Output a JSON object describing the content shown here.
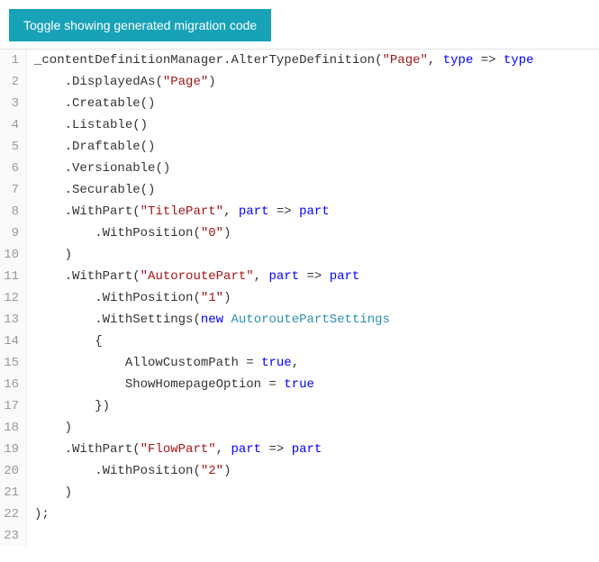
{
  "button": {
    "label": "Toggle showing generated migration code"
  },
  "code": {
    "lines": [
      [
        {
          "t": "ident",
          "v": "_contentDefinitionManager"
        },
        {
          "t": "punct",
          "v": "."
        },
        {
          "t": "ident",
          "v": "AlterTypeDefinition"
        },
        {
          "t": "punct",
          "v": "("
        },
        {
          "t": "string",
          "v": "\"Page\""
        },
        {
          "t": "punct",
          "v": ", "
        },
        {
          "t": "keyword",
          "v": "type"
        },
        {
          "t": "punct",
          "v": " => "
        },
        {
          "t": "keyword",
          "v": "type"
        }
      ],
      [
        {
          "t": "punct",
          "v": "    ."
        },
        {
          "t": "ident",
          "v": "DisplayedAs"
        },
        {
          "t": "punct",
          "v": "("
        },
        {
          "t": "string",
          "v": "\"Page\""
        },
        {
          "t": "punct",
          "v": ")"
        }
      ],
      [
        {
          "t": "punct",
          "v": "    ."
        },
        {
          "t": "ident",
          "v": "Creatable"
        },
        {
          "t": "punct",
          "v": "()"
        }
      ],
      [
        {
          "t": "punct",
          "v": "    ."
        },
        {
          "t": "ident",
          "v": "Listable"
        },
        {
          "t": "punct",
          "v": "()"
        }
      ],
      [
        {
          "t": "punct",
          "v": "    ."
        },
        {
          "t": "ident",
          "v": "Draftable"
        },
        {
          "t": "punct",
          "v": "()"
        }
      ],
      [
        {
          "t": "punct",
          "v": "    ."
        },
        {
          "t": "ident",
          "v": "Versionable"
        },
        {
          "t": "punct",
          "v": "()"
        }
      ],
      [
        {
          "t": "punct",
          "v": "    ."
        },
        {
          "t": "ident",
          "v": "Securable"
        },
        {
          "t": "punct",
          "v": "()"
        }
      ],
      [
        {
          "t": "punct",
          "v": "    ."
        },
        {
          "t": "ident",
          "v": "WithPart"
        },
        {
          "t": "punct",
          "v": "("
        },
        {
          "t": "string",
          "v": "\"TitlePart\""
        },
        {
          "t": "punct",
          "v": ", "
        },
        {
          "t": "keyword",
          "v": "part"
        },
        {
          "t": "punct",
          "v": " => "
        },
        {
          "t": "keyword",
          "v": "part"
        }
      ],
      [
        {
          "t": "punct",
          "v": "        ."
        },
        {
          "t": "ident",
          "v": "WithPosition"
        },
        {
          "t": "punct",
          "v": "("
        },
        {
          "t": "string",
          "v": "\"0\""
        },
        {
          "t": "punct",
          "v": ")"
        }
      ],
      [
        {
          "t": "punct",
          "v": "    )"
        }
      ],
      [
        {
          "t": "punct",
          "v": "    ."
        },
        {
          "t": "ident",
          "v": "WithPart"
        },
        {
          "t": "punct",
          "v": "("
        },
        {
          "t": "string",
          "v": "\"AutoroutePart\""
        },
        {
          "t": "punct",
          "v": ", "
        },
        {
          "t": "keyword",
          "v": "part"
        },
        {
          "t": "punct",
          "v": " => "
        },
        {
          "t": "keyword",
          "v": "part"
        }
      ],
      [
        {
          "t": "punct",
          "v": "        ."
        },
        {
          "t": "ident",
          "v": "WithPosition"
        },
        {
          "t": "punct",
          "v": "("
        },
        {
          "t": "string",
          "v": "\"1\""
        },
        {
          "t": "punct",
          "v": ")"
        }
      ],
      [
        {
          "t": "punct",
          "v": "        ."
        },
        {
          "t": "ident",
          "v": "WithSettings"
        },
        {
          "t": "punct",
          "v": "("
        },
        {
          "t": "keyword",
          "v": "new"
        },
        {
          "t": "punct",
          "v": " "
        },
        {
          "t": "type",
          "v": "AutoroutePartSettings"
        }
      ],
      [
        {
          "t": "punct",
          "v": "        {"
        }
      ],
      [
        {
          "t": "punct",
          "v": "            "
        },
        {
          "t": "ident",
          "v": "AllowCustomPath"
        },
        {
          "t": "punct",
          "v": " = "
        },
        {
          "t": "keyword",
          "v": "true"
        },
        {
          "t": "punct",
          "v": ","
        }
      ],
      [
        {
          "t": "punct",
          "v": "            "
        },
        {
          "t": "ident",
          "v": "ShowHomepageOption"
        },
        {
          "t": "punct",
          "v": " = "
        },
        {
          "t": "keyword",
          "v": "true"
        }
      ],
      [
        {
          "t": "punct",
          "v": "        })"
        }
      ],
      [
        {
          "t": "punct",
          "v": "    )"
        }
      ],
      [
        {
          "t": "punct",
          "v": "    ."
        },
        {
          "t": "ident",
          "v": "WithPart"
        },
        {
          "t": "punct",
          "v": "("
        },
        {
          "t": "string",
          "v": "\"FlowPart\""
        },
        {
          "t": "punct",
          "v": ", "
        },
        {
          "t": "keyword",
          "v": "part"
        },
        {
          "t": "punct",
          "v": " => "
        },
        {
          "t": "keyword",
          "v": "part"
        }
      ],
      [
        {
          "t": "punct",
          "v": "        ."
        },
        {
          "t": "ident",
          "v": "WithPosition"
        },
        {
          "t": "punct",
          "v": "("
        },
        {
          "t": "string",
          "v": "\"2\""
        },
        {
          "t": "punct",
          "v": ")"
        }
      ],
      [
        {
          "t": "punct",
          "v": "    )"
        }
      ],
      [
        {
          "t": "punct",
          "v": ");"
        }
      ],
      []
    ]
  }
}
